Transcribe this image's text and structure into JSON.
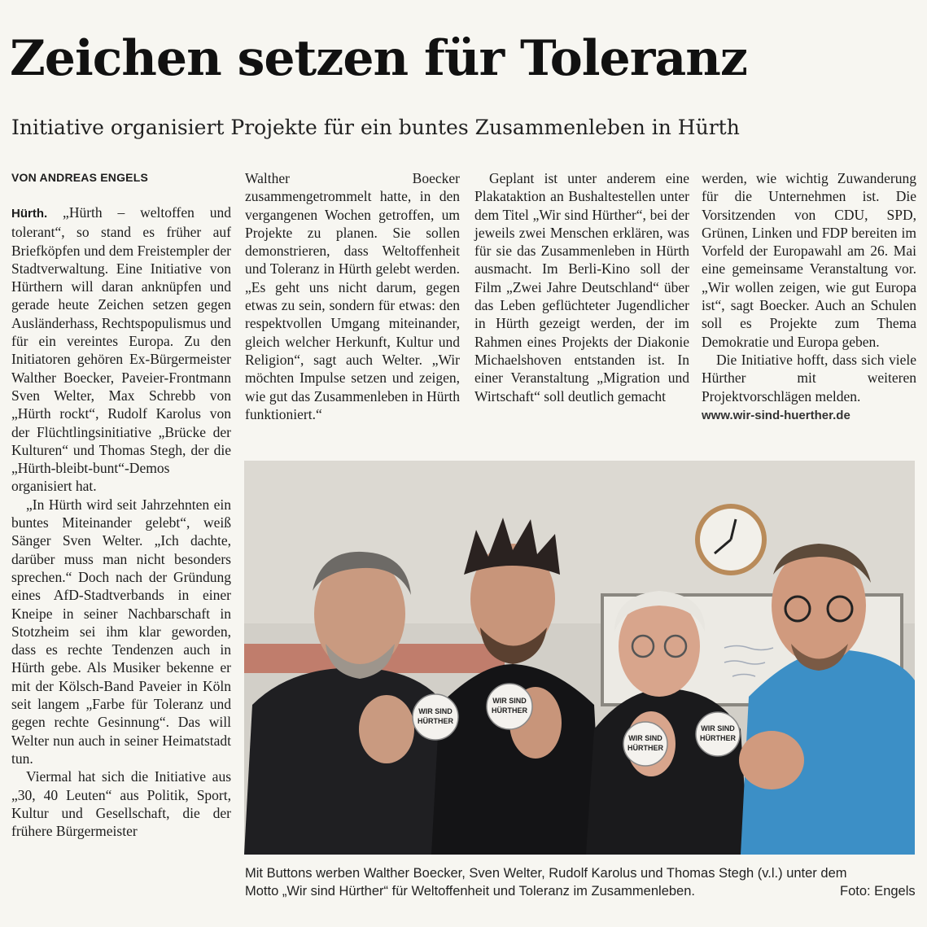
{
  "article": {
    "headline": "Zeichen setzen für Toleranz",
    "subheadline": "Initiative organisiert Projekte für ein buntes Zusammenleben in Hürth",
    "byline": "VON ANDREAS ENGELS",
    "dateline": "Hürth.",
    "col1_p1": "„Hürth – weltoffen und tolerant“, so stand es früher auf Briefköpfen und dem Freistempler der Stadtverwaltung. Eine Initiative von Hürthern will daran anknüpfen und gerade heute Zeichen setzen gegen Ausländerhass, Rechtspopulismus und für ein vereintes Europa. Zu den Initiatoren gehören Ex-Bürgermeister Walther Boecker, Paveier-Frontmann Sven Welter, Max Schrebb von „Hürth rockt“, Rudolf Karolus von der Flüchtlingsinitiative „Brücke der Kulturen“ und Thomas Stegh, der die „Hürth-bleibt-bunt“-Demos organisiert hat.",
    "col1_p2": "„In Hürth wird seit Jahrzehnten ein buntes Miteinander gelebt“, weiß Sänger Sven Welter. „Ich dachte, darüber muss man nicht besonders sprechen.“ Doch nach der Gründung eines AfD-Stadtverbands in einer Kneipe in seiner Nachbarschaft in Stotzheim sei ihm klar geworden, dass es rechte Tendenzen auch in Hürth gebe. Als Musiker bekenne er mit der Kölsch-Band Paveier in Köln seit langem „Farbe für Toleranz und gegen rechte Gesinnung“. Das will Welter nun auch in seiner Heimatstadt tun.",
    "col1_p3": "Viermal hat sich die Initiative aus „30, 40 Leuten“ aus Politik, Sport, Kultur und Gesellschaft, die der frühere Bürgermeister",
    "col2_p1": "Walther Boecker zusammengetrommelt hatte, in den vergangenen Wochen getroffen, um Projekte zu planen. Sie sollen demonstrieren, dass Weltoffenheit und Toleranz in Hürth gelebt werden. „Es geht uns nicht darum, gegen etwas zu sein, sondern für etwas: den respektvollen Umgang miteinander, gleich welcher Herkunft, Kultur und Religion“, sagt auch Welter. „Wir möchten Impulse setzen und zeigen, wie gut das Zusammenleben in Hürth funktioniert.“",
    "col3_p1": "Geplant ist unter anderem eine Plakataktion an Bushaltestellen unter dem Titel „Wir sind Hürther“, bei der jeweils zwei Menschen erklären, was für sie das Zusammenleben in Hürth ausmacht. Im Berli-Kino soll der Film „Zwei Jahre Deutschland“ über das Leben geflüchteter Jugendlicher in Hürth gezeigt werden, der im Rahmen eines Projekts der Diakonie Michaelshoven entstanden ist. In einer Veranstaltung „Migration und Wirtschaft“ soll deutlich gemacht",
    "col4_p1": "werden, wie wichtig Zuwanderung für die Unternehmen ist. Die Vorsitzenden von CDU, SPD, Grünen, Linken und FDP bereiten im Vorfeld der Europawahl am 26. Mai eine gemeinsame Veranstaltung vor. „Wir wollen zeigen, wie gut Europa ist“, sagt Boecker. Auch an Schulen soll es Projekte zum Thema Demokratie und Europa geben.",
    "col4_p2": "Die Initiative hofft, dass sich viele Hürther mit weiteren Projektvorschlägen melden.",
    "website": "www.wir-sind-huerther.de"
  },
  "photo": {
    "button_text_line1": "WIR SIND",
    "button_text_line2": "HÜRTHER",
    "caption": "Mit Buttons werben Walther Boecker, Sven Welter, Rudolf Karolus und Thomas Stegh (v.l.) unter dem Motto „Wir sind Hürther“ für Weltoffenheit und Toleranz im Zusammenleben.",
    "credit": "Foto: Engels"
  },
  "colors": {
    "paper": "#f7f6f1",
    "ink": "#111111",
    "jacket_blue": "#3c8fc6",
    "wall": "#d4d1ca"
  }
}
